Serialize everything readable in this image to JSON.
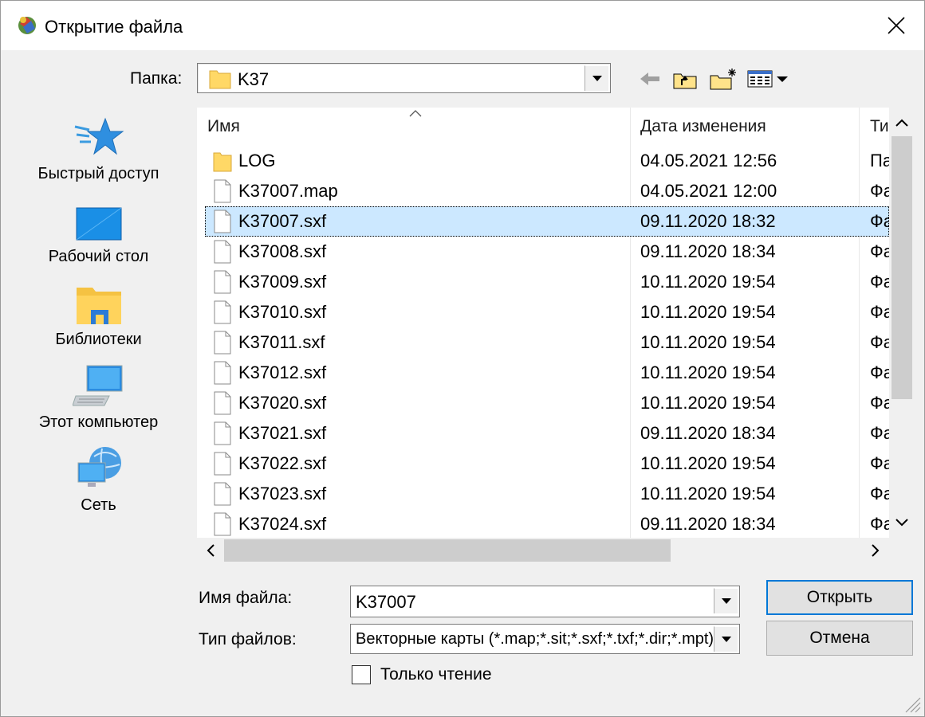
{
  "window": {
    "title": "Открытие файла"
  },
  "folder": {
    "label": "Папка:",
    "current": "K37"
  },
  "places": [
    {
      "label": "Быстрый доступ",
      "icon": "quick-access-star-icon"
    },
    {
      "label": "Рабочий стол",
      "icon": "desktop-icon"
    },
    {
      "label": "Библиотеки",
      "icon": "libraries-icon"
    },
    {
      "label": "Этот компьютер",
      "icon": "this-pc-icon"
    },
    {
      "label": "Сеть",
      "icon": "network-icon"
    }
  ],
  "list": {
    "columns": [
      "Имя",
      "Дата изменения",
      "Ти"
    ],
    "rows": [
      {
        "name": "LOG",
        "date": "04.05.2021 12:56",
        "type": "Па",
        "kind": "folder"
      },
      {
        "name": "K37007.map",
        "date": "04.05.2021 12:00",
        "type": "Фа",
        "kind": "file"
      },
      {
        "name": "K37007.sxf",
        "date": "09.11.2020 18:32",
        "type": "Фа",
        "kind": "file",
        "selected": true
      },
      {
        "name": "K37008.sxf",
        "date": "09.11.2020 18:34",
        "type": "Фа",
        "kind": "file"
      },
      {
        "name": "K37009.sxf",
        "date": "10.11.2020 19:54",
        "type": "Фа",
        "kind": "file"
      },
      {
        "name": "K37010.sxf",
        "date": "10.11.2020 19:54",
        "type": "Фа",
        "kind": "file"
      },
      {
        "name": "K37011.sxf",
        "date": "10.11.2020 19:54",
        "type": "Фа",
        "kind": "file"
      },
      {
        "name": "K37012.sxf",
        "date": "10.11.2020 19:54",
        "type": "Фа",
        "kind": "file"
      },
      {
        "name": "K37020.sxf",
        "date": "10.11.2020 19:54",
        "type": "Фа",
        "kind": "file"
      },
      {
        "name": "K37021.sxf",
        "date": "09.11.2020 18:34",
        "type": "Фа",
        "kind": "file"
      },
      {
        "name": "K37022.sxf",
        "date": "10.11.2020 19:54",
        "type": "Фа",
        "kind": "file"
      },
      {
        "name": "K37023.sxf",
        "date": "10.11.2020 19:54",
        "type": "Фа",
        "kind": "file"
      },
      {
        "name": "K37024.sxf",
        "date": "09.11.2020 18:34",
        "type": "Фа",
        "kind": "file"
      }
    ]
  },
  "form": {
    "filename_label": "Имя файла:",
    "filename_value": "K37007",
    "filetype_label": "Тип файлов:",
    "filetype_value": "Векторные карты (*.map;*.sit;*.sxf;*.txf;*.dir;*.mpt)",
    "readonly_label": "Только чтение",
    "open_button": "Открыть",
    "cancel_button": "Отмена"
  },
  "colors": {
    "selection": "#cce8ff",
    "folder": "#ffd866",
    "accent": "#0078d7"
  }
}
